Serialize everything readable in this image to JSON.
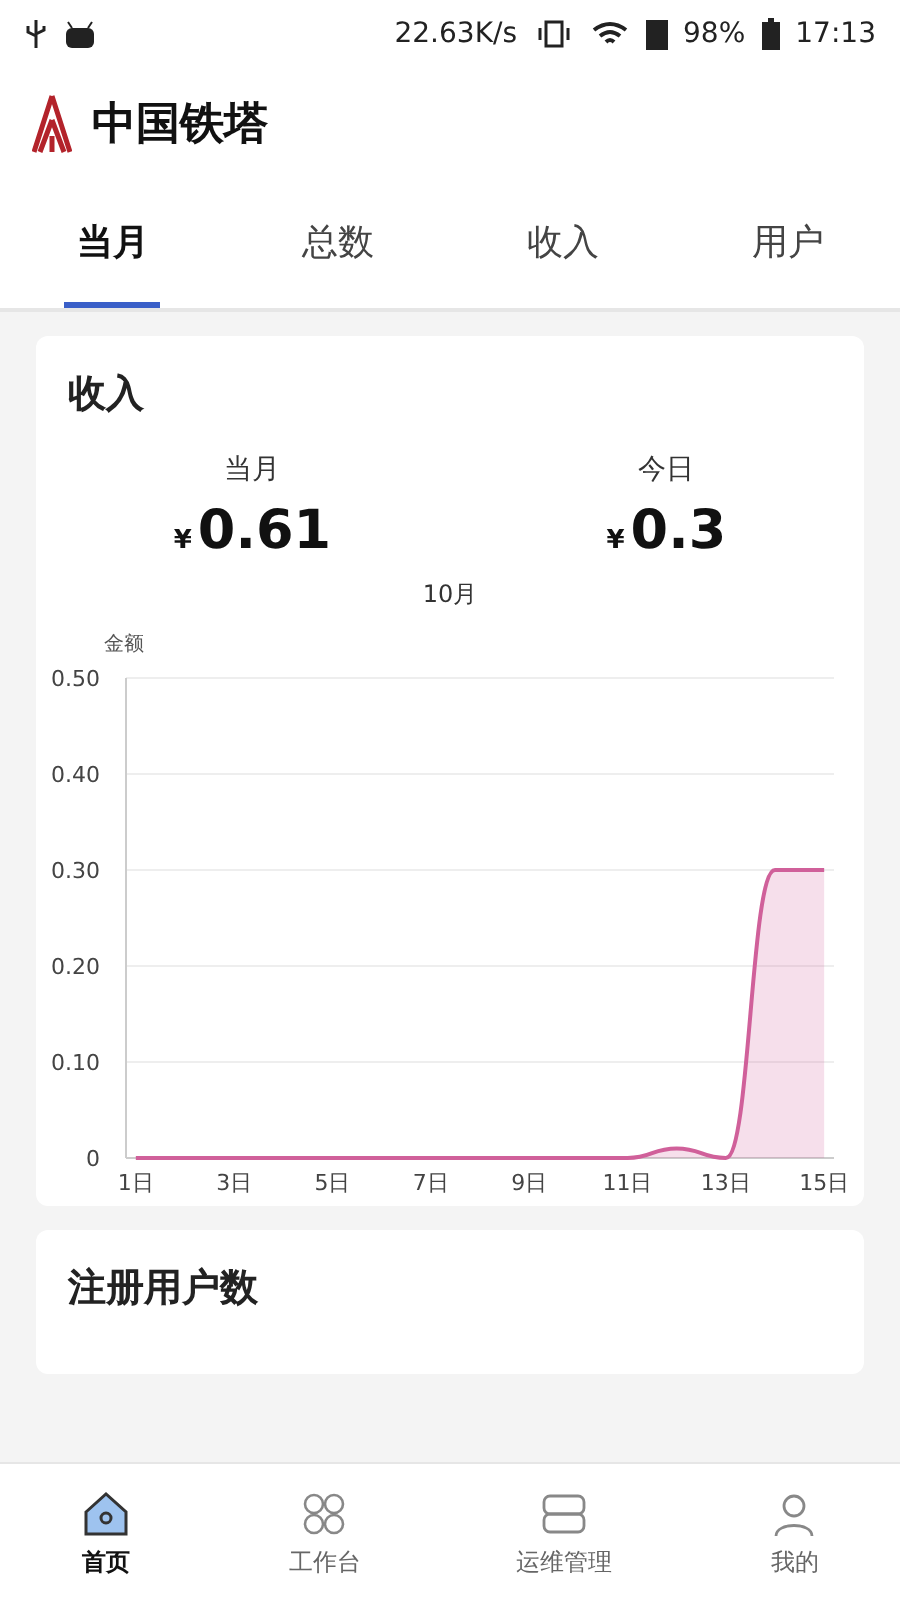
{
  "status_bar": {
    "speed": "22.63K/s",
    "battery": "98%",
    "time": "17:13"
  },
  "app_bar": {
    "title": "中国铁塔"
  },
  "tabs": [
    {
      "label": "当月",
      "selected": true
    },
    {
      "label": "总数",
      "selected": false
    },
    {
      "label": "收入",
      "selected": false
    },
    {
      "label": "用户",
      "selected": false
    }
  ],
  "income_card": {
    "title": "收入",
    "stats": [
      {
        "label": "当月",
        "currency": "¥",
        "value": "0.61"
      },
      {
        "label": "今日",
        "currency": "¥",
        "value": "0.3"
      }
    ],
    "chart_data": {
      "type": "area",
      "title": "10月",
      "ylabel": "金额",
      "x": [
        1,
        2,
        3,
        4,
        5,
        6,
        7,
        8,
        9,
        10,
        11,
        12,
        13,
        14,
        15
      ],
      "series": [
        {
          "color": "#d0609a",
          "values": [
            0,
            0,
            0,
            0,
            0,
            0,
            0,
            0,
            0,
            0,
            0,
            0.01,
            0,
            0.3,
            0.3
          ]
        }
      ],
      "ylim": [
        0,
        0.5
      ],
      "xlim": [
        0.8,
        15.2
      ],
      "grid": true,
      "yticks": [
        {
          "value": 0,
          "label": "0"
        },
        {
          "value": 0.1,
          "label": "0.10"
        },
        {
          "value": 0.2,
          "label": "0.20"
        },
        {
          "value": 0.3,
          "label": "0.30"
        },
        {
          "value": 0.4,
          "label": "0.40"
        },
        {
          "value": 0.5,
          "label": "0.50"
        }
      ],
      "xticks": [
        {
          "value": 1,
          "label": "1日"
        },
        {
          "value": 3,
          "label": "3日"
        },
        {
          "value": 5,
          "label": "5日"
        },
        {
          "value": 7,
          "label": "7日"
        },
        {
          "value": 9,
          "label": "9日"
        },
        {
          "value": 11,
          "label": "11日"
        },
        {
          "value": 13,
          "label": "13日"
        },
        {
          "value": 15,
          "label": "15日"
        }
      ]
    }
  },
  "users_card": {
    "title": "注册用户数"
  },
  "bottom_nav": [
    {
      "label": "首页",
      "kind": "home",
      "selected": true
    },
    {
      "label": "工作台",
      "kind": "workbench",
      "selected": false
    },
    {
      "label": "运维管理",
      "kind": "manage",
      "selected": false
    },
    {
      "label": "我的",
      "kind": "me",
      "selected": false
    }
  ]
}
